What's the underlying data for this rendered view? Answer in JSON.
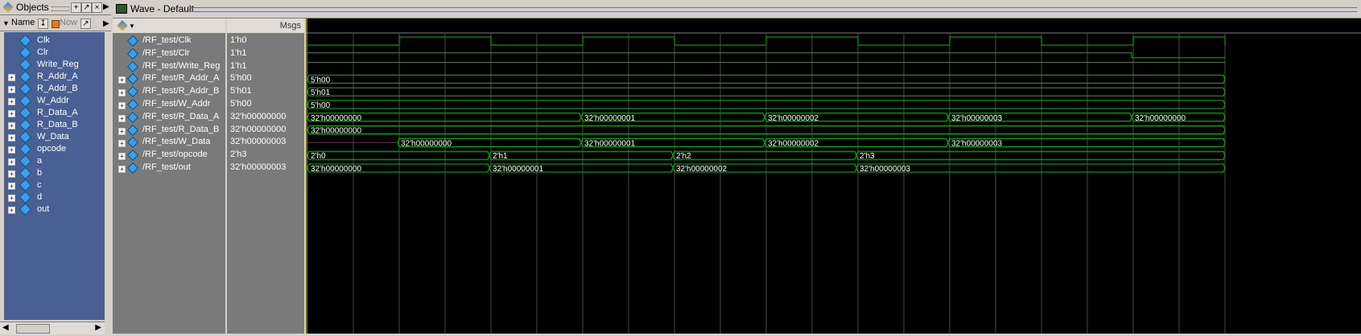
{
  "objects_panel": {
    "title": "Objects",
    "col_name": "Name",
    "col_now": "Now",
    "items": [
      {
        "name": "Clk",
        "expandable": false
      },
      {
        "name": "Clr",
        "expandable": false
      },
      {
        "name": "Write_Reg",
        "expandable": false
      },
      {
        "name": "R_Addr_A",
        "expandable": true
      },
      {
        "name": "R_Addr_B",
        "expandable": true
      },
      {
        "name": "W_Addr",
        "expandable": true
      },
      {
        "name": "R_Data_A",
        "expandable": true
      },
      {
        "name": "R_Data_B",
        "expandable": true
      },
      {
        "name": "W_Data",
        "expandable": true
      },
      {
        "name": "opcode",
        "expandable": true
      },
      {
        "name": "a",
        "expandable": true
      },
      {
        "name": "b",
        "expandable": true
      },
      {
        "name": "c",
        "expandable": true
      },
      {
        "name": "d",
        "expandable": true
      },
      {
        "name": "out",
        "expandable": true
      }
    ]
  },
  "wave_window": {
    "title": "Wave - Default",
    "msgs_header": "Msgs",
    "signals": [
      {
        "path": "/RF_test/Clk",
        "value": "1'h0",
        "expandable": false
      },
      {
        "path": "/RF_test/Clr",
        "value": "1'h1",
        "expandable": false
      },
      {
        "path": "/RF_test/Write_Reg",
        "value": "1'h1",
        "expandable": false
      },
      {
        "path": "/RF_test/R_Addr_A",
        "value": "5'h00",
        "expandable": true
      },
      {
        "path": "/RF_test/R_Addr_B",
        "value": "5'h01",
        "expandable": true
      },
      {
        "path": "/RF_test/W_Addr",
        "value": "5'h00",
        "expandable": true
      },
      {
        "path": "/RF_test/R_Data_A",
        "value": "32'h00000000",
        "expandable": true
      },
      {
        "path": "/RF_test/R_Data_B",
        "value": "32'h00000000",
        "expandable": true
      },
      {
        "path": "/RF_test/W_Data",
        "value": "32'h00000003",
        "expandable": true
      },
      {
        "path": "/RF_test/opcode",
        "value": "2'h3",
        "expandable": true
      },
      {
        "path": "/RF_test/out",
        "value": "32'h00000003",
        "expandable": true
      }
    ],
    "bus_labels": {
      "R_Addr_A": [
        "5'h00"
      ],
      "R_Addr_B": [
        "5'h01"
      ],
      "W_Addr": [
        "5'h00"
      ],
      "R_Data_A": [
        "32'h00000000",
        "32'h00000001",
        "32'h00000002",
        "32'h00000003",
        "32'h00000000"
      ],
      "R_Data_B": [
        "32'h00000000"
      ],
      "W_Data": [
        "32'h00000000",
        "32'h00000001",
        "32'h00000002",
        "32'h00000003"
      ],
      "opcode": [
        "2'h0",
        "2'h1",
        "2'h2",
        "2'h3"
      ],
      "out": [
        "32'h00000000",
        "32'h00000001",
        "32'h00000002",
        "32'h00000003"
      ]
    },
    "colors": {
      "waveform": "#00c000",
      "cursor": "#e0e000",
      "undefined": "#e00000",
      "grid": "#4a4a4a"
    }
  }
}
